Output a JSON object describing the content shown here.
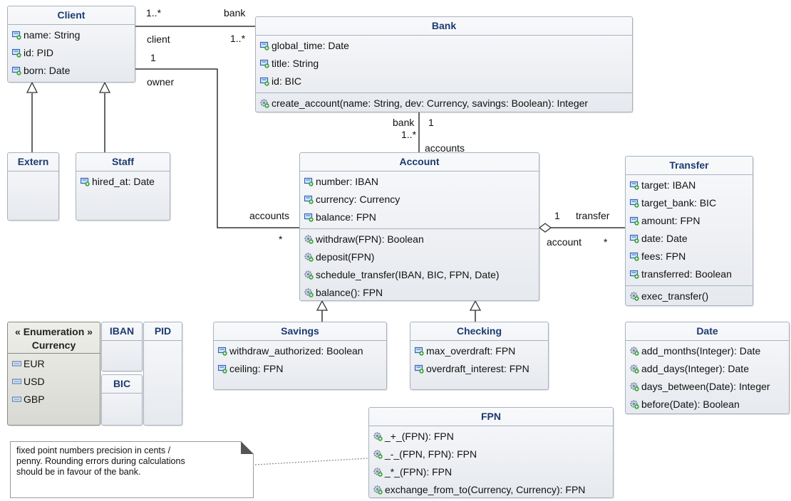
{
  "classes": {
    "client": {
      "name": "Client",
      "attributes": [
        "name: String",
        "id: PID",
        "born: Date"
      ]
    },
    "extern": {
      "name": "Extern"
    },
    "staff": {
      "name": "Staff",
      "attributes": [
        "hired_at: Date"
      ]
    },
    "bank": {
      "name": "Bank",
      "attributes": [
        "global_time: Date",
        "title: String",
        "id: BIC"
      ],
      "operations": [
        "create_account(name: String, dev: Currency, savings: Boolean): Integer"
      ]
    },
    "account": {
      "name": "Account",
      "attributes": [
        "number: IBAN",
        "currency: Currency",
        "balance: FPN"
      ],
      "operations": [
        "withdraw(FPN): Boolean",
        "deposit(FPN)",
        "schedule_transfer(IBAN, BIC, FPN, Date)",
        "balance(): FPN"
      ]
    },
    "transfer": {
      "name": "Transfer",
      "attributes": [
        "target: IBAN",
        "target_bank: BIC",
        "amount: FPN",
        "date: Date",
        "fees: FPN",
        "transferred: Boolean"
      ],
      "operations": [
        "exec_transfer()"
      ]
    },
    "savings": {
      "name": "Savings",
      "attributes": [
        "withdraw_authorized: Boolean",
        "ceiling: FPN"
      ]
    },
    "checking": {
      "name": "Checking",
      "attributes": [
        "max_overdraft: FPN",
        "overdraft_interest: FPN"
      ]
    },
    "currency": {
      "stereotype": "« Enumeration »",
      "name": "Currency",
      "literals": [
        "EUR",
        "USD",
        "GBP"
      ]
    },
    "iban": {
      "name": "IBAN"
    },
    "pid": {
      "name": "PID"
    },
    "bic": {
      "name": "BIC"
    },
    "date": {
      "name": "Date",
      "operations": [
        "add_months(Integer): Date",
        "add_days(Integer): Date",
        "days_between(Date): Integer",
        "before(Date): Boolean"
      ]
    },
    "fpn": {
      "name": "FPN",
      "operations": [
        "_+_(FPN): FPN",
        "_-_(FPN, FPN): FPN",
        "_*_(FPN): FPN",
        "exchange_from_to(Currency, Currency): FPN"
      ]
    }
  },
  "associations": {
    "client_bank": {
      "client_mult": "1..*",
      "bank_role": "bank",
      "client_role": "client",
      "bank_mult": "1..*"
    },
    "client_account": {
      "owner_mult": "1",
      "owner_role": "owner",
      "accounts_role": "accounts",
      "accounts_mult": "*"
    },
    "bank_account": {
      "bank_role": "bank",
      "bank_mult": "1",
      "accounts_mult": "1..*",
      "accounts_role": "accounts"
    },
    "account_transfer": {
      "account_mult": "1",
      "transfer_role": "transfer",
      "account_role": "account",
      "transfer_mult": "*"
    }
  },
  "note": {
    "lines": [
      "fixed point numbers precision in cents /",
      "penny. Rounding errors during calculations",
      "should be in favour of the bank."
    ]
  },
  "colors": {
    "title": "#1c3a70",
    "box_border": "#a9b2bf",
    "attribute_icon": "#2b62b8",
    "attribute_plus": "#3aa23a",
    "operation_icon": "#6b7f9c",
    "enum_literal_icon": "#5b7fb0"
  },
  "icons": {
    "attribute": "attribute-icon",
    "operation": "operation-icon",
    "literal": "enum-literal-icon"
  }
}
